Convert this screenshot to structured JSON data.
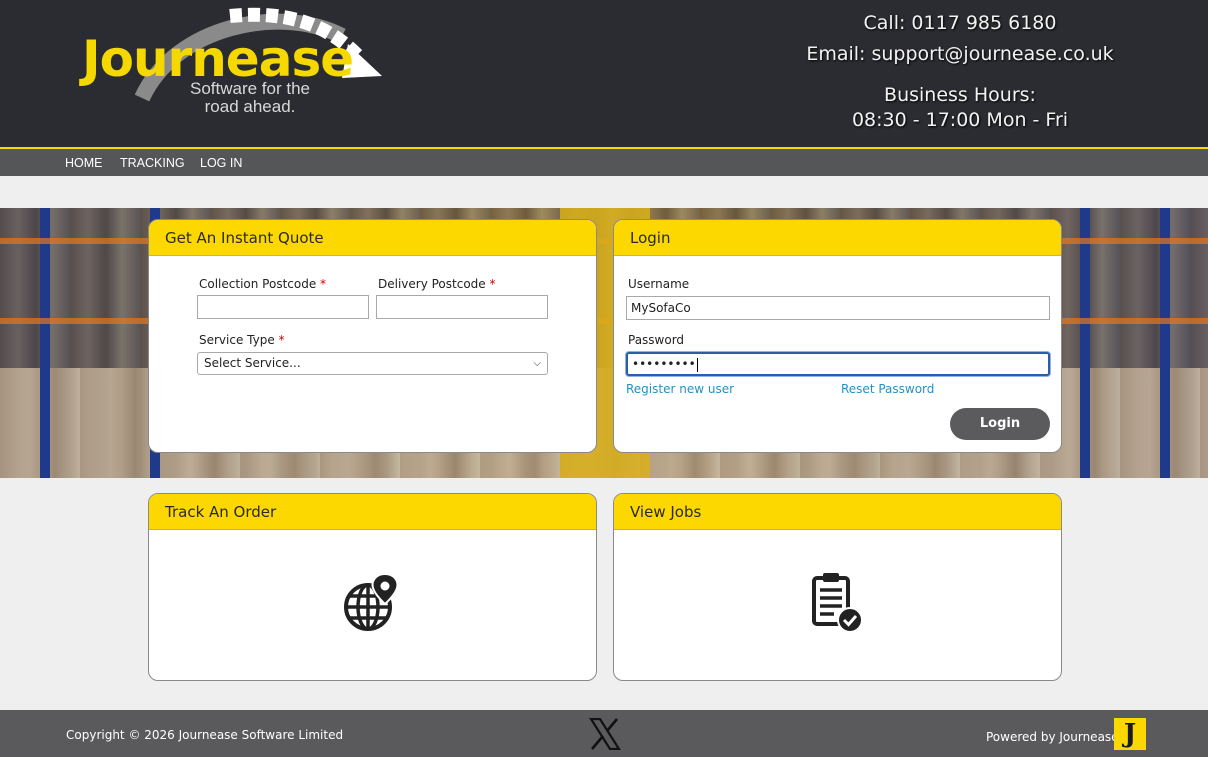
{
  "brand": {
    "name": "Journease",
    "tagline_line1": "Software for the",
    "tagline_line2": "road ahead."
  },
  "contact": {
    "call": "Call: 0117 985 6180",
    "email": "Email: support@journease.co.uk",
    "hours_label": "Business Hours:",
    "hours_value": "08:30 - 17:00 Mon - Fri"
  },
  "nav": {
    "items": [
      {
        "label": "HOME"
      },
      {
        "label": "TRACKING"
      },
      {
        "label": "LOG IN"
      }
    ]
  },
  "quote": {
    "title": "Get An Instant Quote",
    "collection_label": "Collection Postcode",
    "delivery_label": "Delivery Postcode",
    "service_label": "Service Type",
    "required_mark": "*",
    "collection_value": "",
    "delivery_value": "",
    "service_selected": "Select Service..."
  },
  "login": {
    "title": "Login",
    "username_label": "Username",
    "username_value": "MySofaCo",
    "password_label": "Password",
    "password_value": "•••••••••",
    "register_link": "Register new user",
    "reset_link": "Reset Password",
    "submit_label": "Login"
  },
  "track": {
    "title": "Track An Order",
    "icon": "globe-location-icon"
  },
  "jobs": {
    "title": "View Jobs",
    "icon": "clipboard-check-icon"
  },
  "footer": {
    "copyright": "Copyright © 2026 Journease Software Limited",
    "social_icon": "x-logo-icon",
    "powered_by": "Powered by Journease",
    "badge_letter": "J"
  },
  "colors": {
    "header_bg": "#2b2c31",
    "accent_yellow": "#fcd800",
    "nav_bg": "#555658",
    "link_blue": "#1f93c9",
    "button_bg": "#5b5b5e",
    "footer_bg": "#5a5a5c"
  }
}
